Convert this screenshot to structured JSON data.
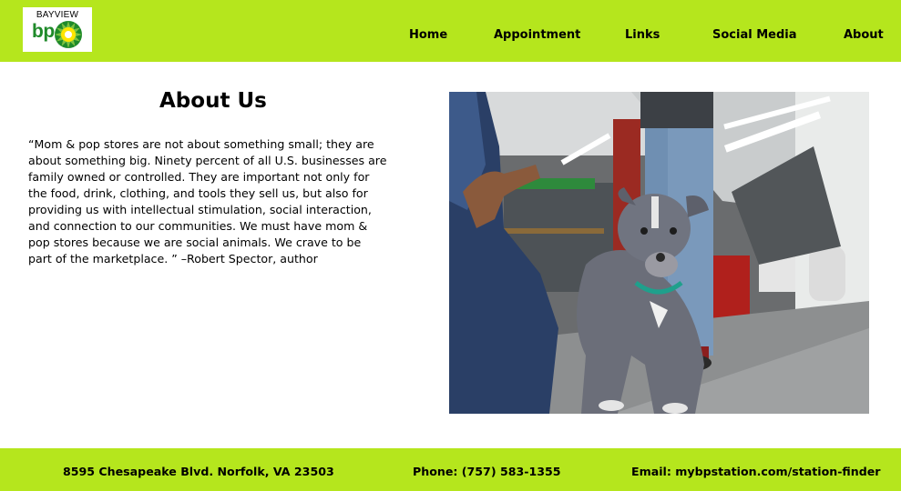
{
  "header": {
    "logo_text": "BAYVIEW",
    "logo_brand": "bp",
    "nav": {
      "home": "Home",
      "appointment": "Appointment",
      "links": "Links",
      "social_media": "Social Media",
      "about": "About"
    }
  },
  "main": {
    "title": "About Us",
    "quote": "“Mom & pop stores are not about something small; they are about something big. Ninety percent of all U.S. businesses are family owned or controlled. They are important not only for the food, drink, clothing, and tools they sell us, but also for providing us with intellectual stimulation, social interaction, and connection to our communities. We must have mom & pop stores because we are social animals. We crave to be part of the marketplace. ” –Robert Spector, author"
  },
  "footer": {
    "address": "8595 Chesapeake Blvd. Norfolk, VA 23503",
    "phone": "Phone: (757) 583-1355",
    "email": "Email: mybpstation.com/station-finder"
  },
  "colors": {
    "brand_green": "#b5e61d",
    "logo_green": "#1f8a2a",
    "logo_yellow": "#ffe600"
  }
}
